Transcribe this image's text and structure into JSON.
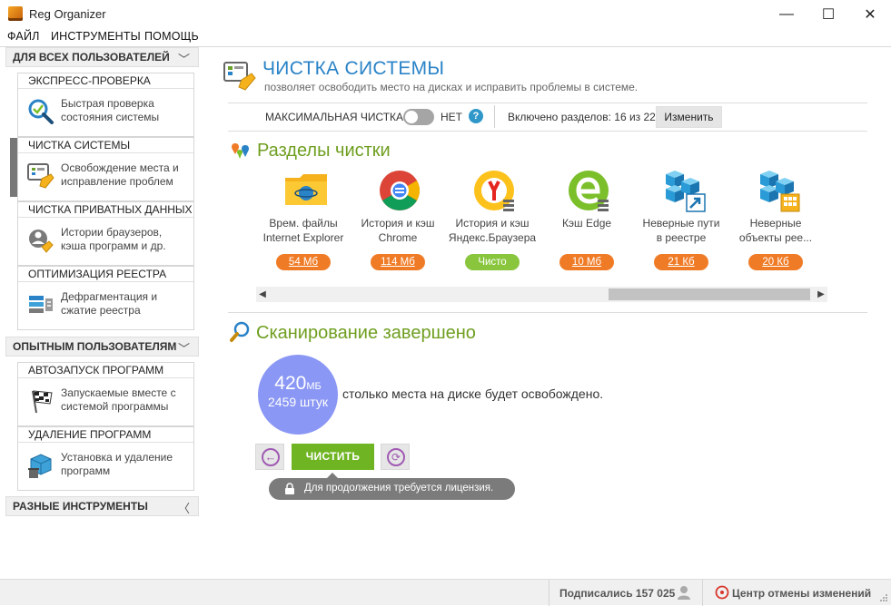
{
  "window": {
    "title": "Reg Organizer",
    "controls": [
      "—",
      "☐",
      "✕"
    ]
  },
  "menu": [
    "ФАЙЛ",
    "ИНСТРУМЕНТЫ",
    "ПОМОЩЬ"
  ],
  "sidebar": {
    "groups": [
      {
        "label": "ДЛЯ ВСЕХ ПОЛЬЗОВАТЕЛЕЙ",
        "chevron": "﹀"
      },
      {
        "label": "ОПЫТНЫМ ПОЛЬЗОВАТЕЛЯМ",
        "chevron": "﹀"
      },
      {
        "label": "РАЗНЫЕ ИНСТРУМЕНТЫ",
        "chevron": "〈"
      }
    ],
    "cards": [
      {
        "title": "ЭКСПРЕСС-ПРОВЕРКА",
        "line1": "Быстрая проверка",
        "line2": "состояния системы",
        "icon": "search-check-icon"
      },
      {
        "title": "ЧИСТКА СИСТЕМЫ",
        "line1": "Освобождение места и",
        "line2": "исправление проблем",
        "icon": "system-cleanup-icon",
        "selected": true
      },
      {
        "title": "ЧИСТКА ПРИВАТНЫХ ДАННЫХ",
        "line1": "Истории браузеров,",
        "line2": "кэша программ и др.",
        "icon": "privacy-cleanup-icon"
      },
      {
        "title": "ОПТИМИЗАЦИЯ РЕЕСТРА",
        "line1": "Дефрагментация и",
        "line2": "сжатие реестра",
        "icon": "registry-defrag-icon"
      },
      {
        "title": "АВТОЗАПУСК ПРОГРАММ",
        "line1": "Запускаемые вместе с",
        "line2": "системой программы",
        "icon": "startup-flag-icon"
      },
      {
        "title": "УДАЛЕНИЕ ПРОГРАММ",
        "line1": "Установка и удаление",
        "line2": "программ",
        "icon": "uninstall-box-icon"
      }
    ]
  },
  "main": {
    "title": "ЧИСТКА СИСТЕМЫ",
    "subtitle": "позволяет освободить место на дисках и исправить проблемы в системе.",
    "option_label": "МАКСИМАЛЬНАЯ ЧИСТКА",
    "option_state": "НЕТ",
    "help": "?",
    "included": "Включено разделов: 16 из 22",
    "change_button": "Изменить",
    "sections_title": "Разделы чистки",
    "tiles": [
      {
        "line1": "Врем. файлы",
        "line2": "Internet Explorer",
        "badge": "54 Мб",
        "clean": false,
        "icon": "internet-explorer-folder-icon"
      },
      {
        "line1": "История и кэш",
        "line2": "Chrome",
        "badge": "114 Мб",
        "clean": false,
        "icon": "chrome-icon"
      },
      {
        "line1": "История и кэш",
        "line2": "Яндекс.Браузера",
        "badge": "Чисто",
        "clean": true,
        "icon": "yandex-browser-icon"
      },
      {
        "line1": "Кэш Edge",
        "line2": "",
        "badge": "10 Мб",
        "clean": false,
        "icon": "edge-icon"
      },
      {
        "line1": "Неверные пути",
        "line2": "в реестре",
        "badge": "21 Кб",
        "clean": false,
        "icon": "registry-paths-icon"
      },
      {
        "line1": "Неверные",
        "line2": "объекты рее...",
        "badge": "20 Кб",
        "clean": false,
        "icon": "registry-objects-icon"
      }
    ],
    "scan_title": "Сканирование завершено",
    "size_value": "420",
    "size_unit": "МБ",
    "count": "2459 штук",
    "scan_text": "столько места на диске будет освобождено.",
    "clean_button": "ЧИСТИТЬ",
    "license_tip": "Для продолжения требуется лицензия.",
    "scroll_position": 0.64
  },
  "status": {
    "subscribed": "Подписались 157 025",
    "undo_center": "Центр отмены изменений"
  },
  "colors": {
    "accent_blue": "#2a83c7",
    "section_green": "#6e9e1f",
    "badge_orange": "#f07b26",
    "badge_green": "#89c63d",
    "clean_button": "#6fb523",
    "circle": "#8a97f4"
  }
}
